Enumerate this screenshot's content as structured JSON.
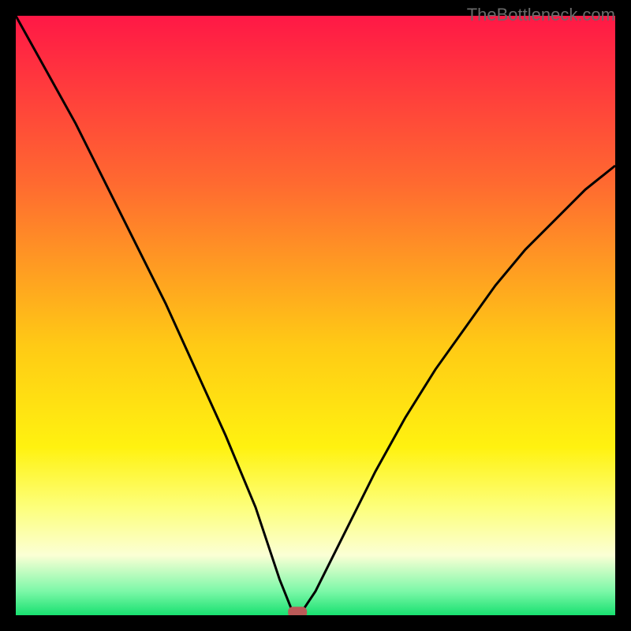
{
  "watermark": "TheBottleneck.com",
  "chart_data": {
    "type": "line",
    "title": "",
    "xlabel": "",
    "ylabel": "",
    "xlim": [
      0,
      100
    ],
    "ylim": [
      0,
      100
    ],
    "notch_x": 47,
    "curve_points": [
      {
        "x": 0,
        "y": 100
      },
      {
        "x": 5,
        "y": 91
      },
      {
        "x": 10,
        "y": 82
      },
      {
        "x": 15,
        "y": 72
      },
      {
        "x": 20,
        "y": 62
      },
      {
        "x": 25,
        "y": 52
      },
      {
        "x": 30,
        "y": 41
      },
      {
        "x": 35,
        "y": 30
      },
      {
        "x": 40,
        "y": 18
      },
      {
        "x": 44,
        "y": 6
      },
      {
        "x": 46,
        "y": 1
      },
      {
        "x": 47,
        "y": 0
      },
      {
        "x": 48,
        "y": 1
      },
      {
        "x": 50,
        "y": 4
      },
      {
        "x": 55,
        "y": 14
      },
      {
        "x": 60,
        "y": 24
      },
      {
        "x": 65,
        "y": 33
      },
      {
        "x": 70,
        "y": 41
      },
      {
        "x": 75,
        "y": 48
      },
      {
        "x": 80,
        "y": 55
      },
      {
        "x": 85,
        "y": 61
      },
      {
        "x": 90,
        "y": 66
      },
      {
        "x": 95,
        "y": 71
      },
      {
        "x": 100,
        "y": 75
      }
    ],
    "gradient_stops": [
      {
        "offset": 0,
        "color": "#ff1846"
      },
      {
        "offset": 28,
        "color": "#ff6a30"
      },
      {
        "offset": 55,
        "color": "#ffca15"
      },
      {
        "offset": 72,
        "color": "#fff210"
      },
      {
        "offset": 82,
        "color": "#fdff7b"
      },
      {
        "offset": 90,
        "color": "#fbffd5"
      },
      {
        "offset": 96,
        "color": "#7cf8a8"
      },
      {
        "offset": 100,
        "color": "#18e070"
      }
    ],
    "marker": {
      "x": 47,
      "y": 0.5,
      "color": "#bb5a58"
    }
  }
}
